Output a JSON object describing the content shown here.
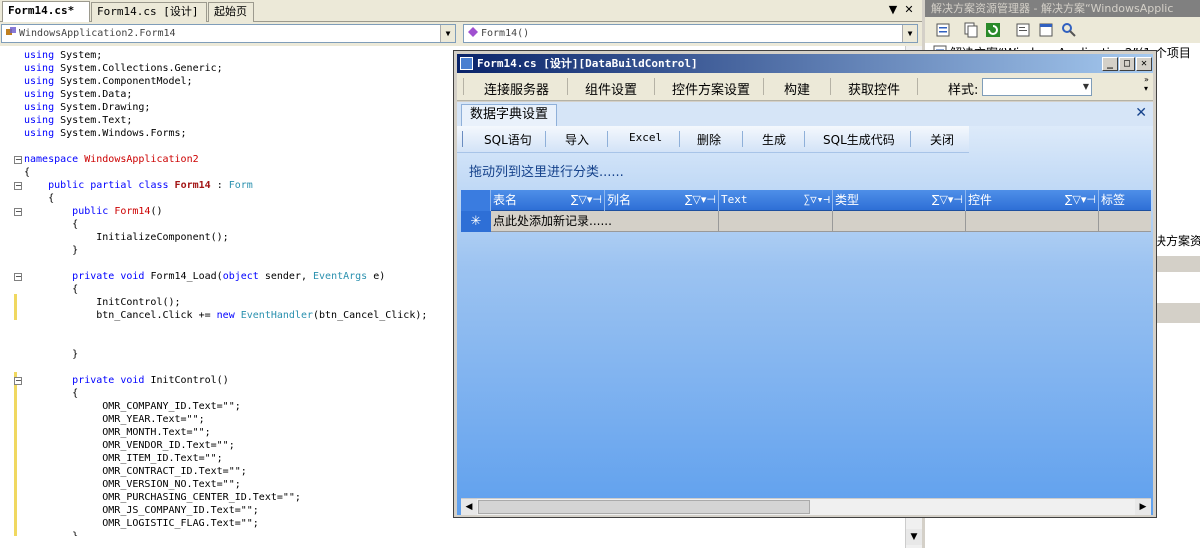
{
  "doc_tabs": [
    {
      "label": "Form14.cs*",
      "active": true
    },
    {
      "label": "Form14.cs [设计]",
      "active": false
    },
    {
      "label": "起始页",
      "active": false
    }
  ],
  "tab_controls": {
    "dropdown": "▼",
    "close": "✕"
  },
  "class_combo": {
    "value": "WindowsApplication2.Form14"
  },
  "member_combo": {
    "value": "Form14()"
  },
  "code_lines": [
    {
      "text": "using System;"
    },
    {
      "text": "using System.Collections.Generic;"
    },
    {
      "text": "using System.ComponentModel;"
    },
    {
      "text": "using System.Data;"
    },
    {
      "text": "using System.Drawing;"
    },
    {
      "text": "using System.Text;"
    },
    {
      "text": "using System.Windows.Forms;"
    },
    {
      "text": ""
    },
    {
      "text": "namespace WindowsApplication2"
    },
    {
      "text": "{"
    },
    {
      "text": "    public partial class Form14 : Form"
    },
    {
      "text": "    {"
    },
    {
      "text": "        public Form14()"
    },
    {
      "text": "        {"
    },
    {
      "text": "            InitializeComponent();"
    },
    {
      "text": "        }"
    },
    {
      "text": ""
    },
    {
      "text": "        private void Form14_Load(object sender, EventArgs e)"
    },
    {
      "text": "        {"
    },
    {
      "text": "            InitControl();"
    },
    {
      "text": "            btn_Cancel.Click += new EventHandler(btn_Cancel_Click);"
    },
    {
      "text": ""
    },
    {
      "text": ""
    },
    {
      "text": "        }"
    },
    {
      "text": ""
    },
    {
      "text": "        private void InitControl()"
    },
    {
      "text": "        {"
    },
    {
      "text": "             OMR_COMPANY_ID.Text=\"\";"
    },
    {
      "text": "             OMR_YEAR.Text=\"\";"
    },
    {
      "text": "             OMR_MONTH.Text=\"\";"
    },
    {
      "text": "             OMR_VENDOR_ID.Text=\"\";"
    },
    {
      "text": "             OMR_ITEM_ID.Text=\"\";"
    },
    {
      "text": "             OMR_CONTRACT_ID.Text=\"\";"
    },
    {
      "text": "             OMR_VERSION_NO.Text=\"\";"
    },
    {
      "text": "             OMR_PURCHASING_CENTER_ID.Text=\"\";"
    },
    {
      "text": "             OMR_JS_COMPANY_ID.Text=\"\";"
    },
    {
      "text": "             OMR_LOGISTIC_FLAG.Text=\"\";"
    },
    {
      "text": "        }"
    }
  ],
  "solution_explorer": {
    "title": "解决方案资源管理器 - 解决方案“WindowsApplic",
    "tree_item": "解决方案“WindowsApplication2”(1 个项目",
    "partial_label": "决方案资"
  },
  "form": {
    "title": "Form14.cs [设计][DataBuildControl]",
    "menu": [
      "连接服务器",
      "组件设置",
      "控件方案设置",
      "构建",
      "获取控件"
    ],
    "style_label": "样式:",
    "style_value": "",
    "inner_tab": "数据字典设置",
    "toolbar": [
      "SQL语句",
      "导入",
      "Excel",
      "删除",
      "生成",
      "SQL生成代码",
      "关闭"
    ],
    "group_hint": "拖动列到这里进行分类......",
    "columns": [
      "表名",
      "列名",
      "Text",
      "类型",
      "控件",
      "标签"
    ],
    "col_ops": "∑▽▾⊣",
    "new_row_marker": "✳",
    "new_row_text": "点此处添加新记录......"
  }
}
